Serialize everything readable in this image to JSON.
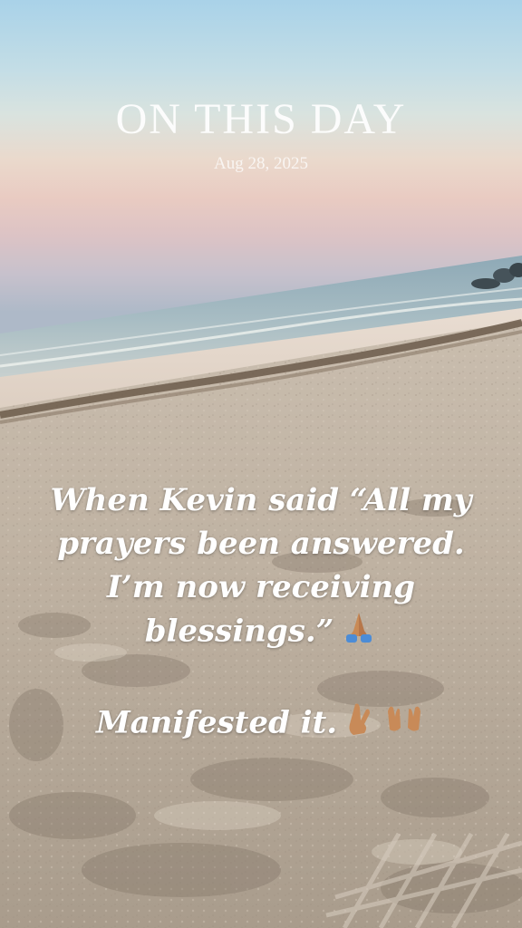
{
  "story": {
    "title": "ON THIS DAY",
    "date": "Aug 28, 2025",
    "caption_lines": [
      "When Kevin said “All my",
      "prayers been answered.",
      "I’m now receiving",
      "blessings.”"
    ],
    "caption_line2": "Manifested it.",
    "emoji_line1": [
      "praying-hands-emoji"
    ],
    "emoji_line2": [
      "crossed-fingers-emoji",
      "raising-hands-emoji"
    ]
  }
}
